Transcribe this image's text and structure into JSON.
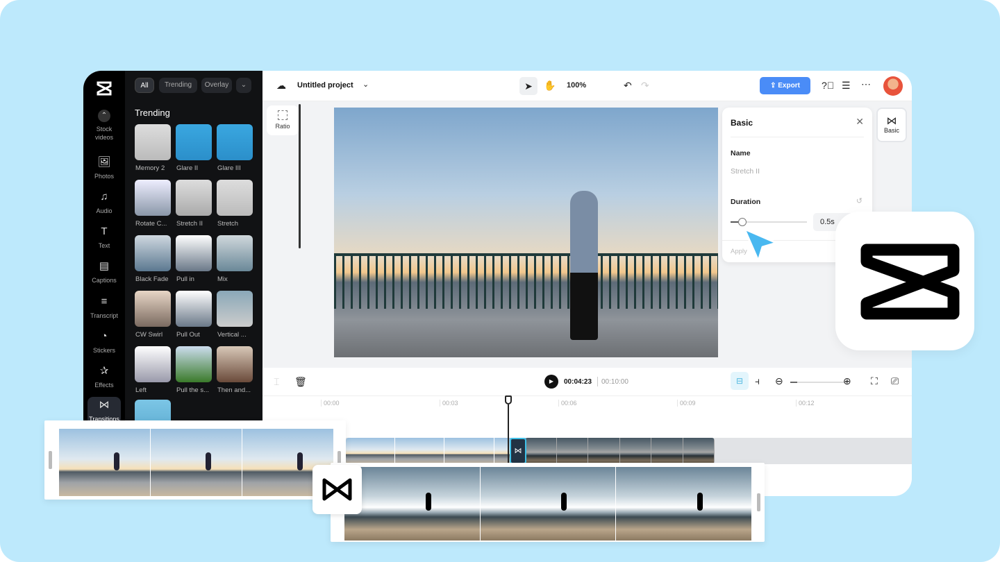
{
  "header": {
    "project_title": "Untitled project",
    "zoom": "100%",
    "export_label": "Export"
  },
  "sidebar": {
    "items": [
      {
        "label": "Stock videos",
        "icon": "chevron-up-icon"
      },
      {
        "label": "Photos",
        "icon": "image-icon"
      },
      {
        "label": "Audio",
        "icon": "music-icon"
      },
      {
        "label": "Text",
        "icon": "text-icon"
      },
      {
        "label": "Captions",
        "icon": "captions-icon"
      },
      {
        "label": "Transcript",
        "icon": "transcript-icon"
      },
      {
        "label": "Stickers",
        "icon": "sticker-icon"
      },
      {
        "label": "Effects",
        "icon": "effects-icon"
      },
      {
        "label": "Transitions",
        "icon": "transition-icon",
        "active": true
      }
    ]
  },
  "panel": {
    "filters": [
      "All",
      "Trending",
      "Overlay"
    ],
    "section_title": "Trending",
    "items": [
      "Memory 2",
      "Glare II",
      "Glare III",
      "Rotate C...",
      "Stretch II",
      "Stretch",
      "Black Fade",
      "Pull in",
      "Mix",
      "CW Swirl",
      "Pull Out",
      "Vertical ...",
      "Left",
      "Pull the s...",
      "Then and..."
    ]
  },
  "canvas": {
    "ratio_label": "Ratio"
  },
  "basic_panel": {
    "title": "Basic",
    "name_label": "Name",
    "name_value": "Stretch II",
    "duration_label": "Duration",
    "duration_value": "0.5s",
    "duration_fraction": 0.15,
    "apply_label": "Apply"
  },
  "right_tab": {
    "label": "Basic"
  },
  "timeline": {
    "current_time": "00:04:23",
    "total_time": "00:10:00",
    "ruler": [
      "00:00",
      "00:03",
      "00:06",
      "00:09",
      "00:12"
    ]
  },
  "colors": {
    "background": "#bde9fc",
    "accent": "#4a8cf7",
    "sidebar": "#000000",
    "panel": "#111214"
  }
}
